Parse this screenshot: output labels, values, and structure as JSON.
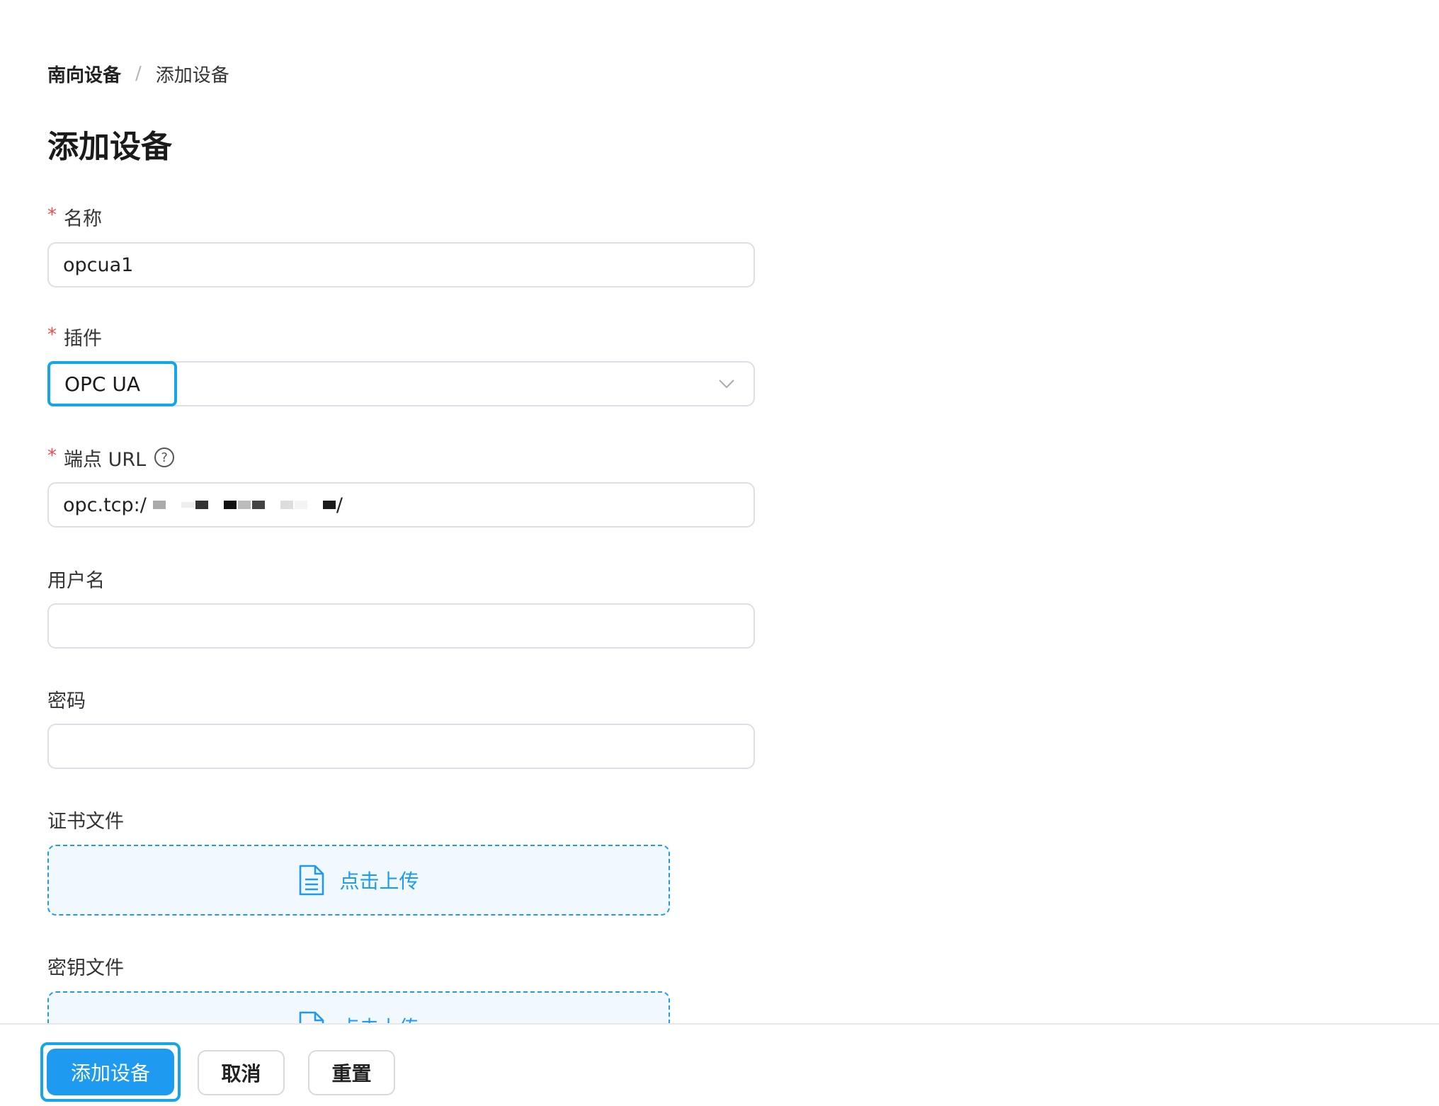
{
  "breadcrumb": {
    "parent": "南向设备",
    "separator": "/",
    "current": "添加设备"
  },
  "page_title": "添加设备",
  "form": {
    "name": {
      "label": "名称",
      "required_mark": "*",
      "value": "opcua1"
    },
    "plugin": {
      "label": "插件",
      "required_mark": "*",
      "value": "OPC UA"
    },
    "endpoint": {
      "label": "端点 URL",
      "required_mark": "*",
      "help_symbol": "?",
      "value_prefix": "opc.tcp:/",
      "value_suffix": "/"
    },
    "username": {
      "label": "用户名",
      "value": ""
    },
    "password": {
      "label": "密码",
      "value": ""
    },
    "cert_file": {
      "label": "证书文件",
      "upload_text": "点击上传"
    },
    "key_file": {
      "label": "密钥文件",
      "upload_text": "点击上传"
    }
  },
  "footer": {
    "submit": "添加设备",
    "cancel": "取消",
    "reset": "重置"
  },
  "colors": {
    "primary": "#1e9bf0",
    "focus_outline": "#14a6ea",
    "required": "#f04b4b"
  },
  "icons": {
    "select_arrow": "chevron-down-icon",
    "help": "question-circle-icon",
    "upload": "file-icon"
  }
}
